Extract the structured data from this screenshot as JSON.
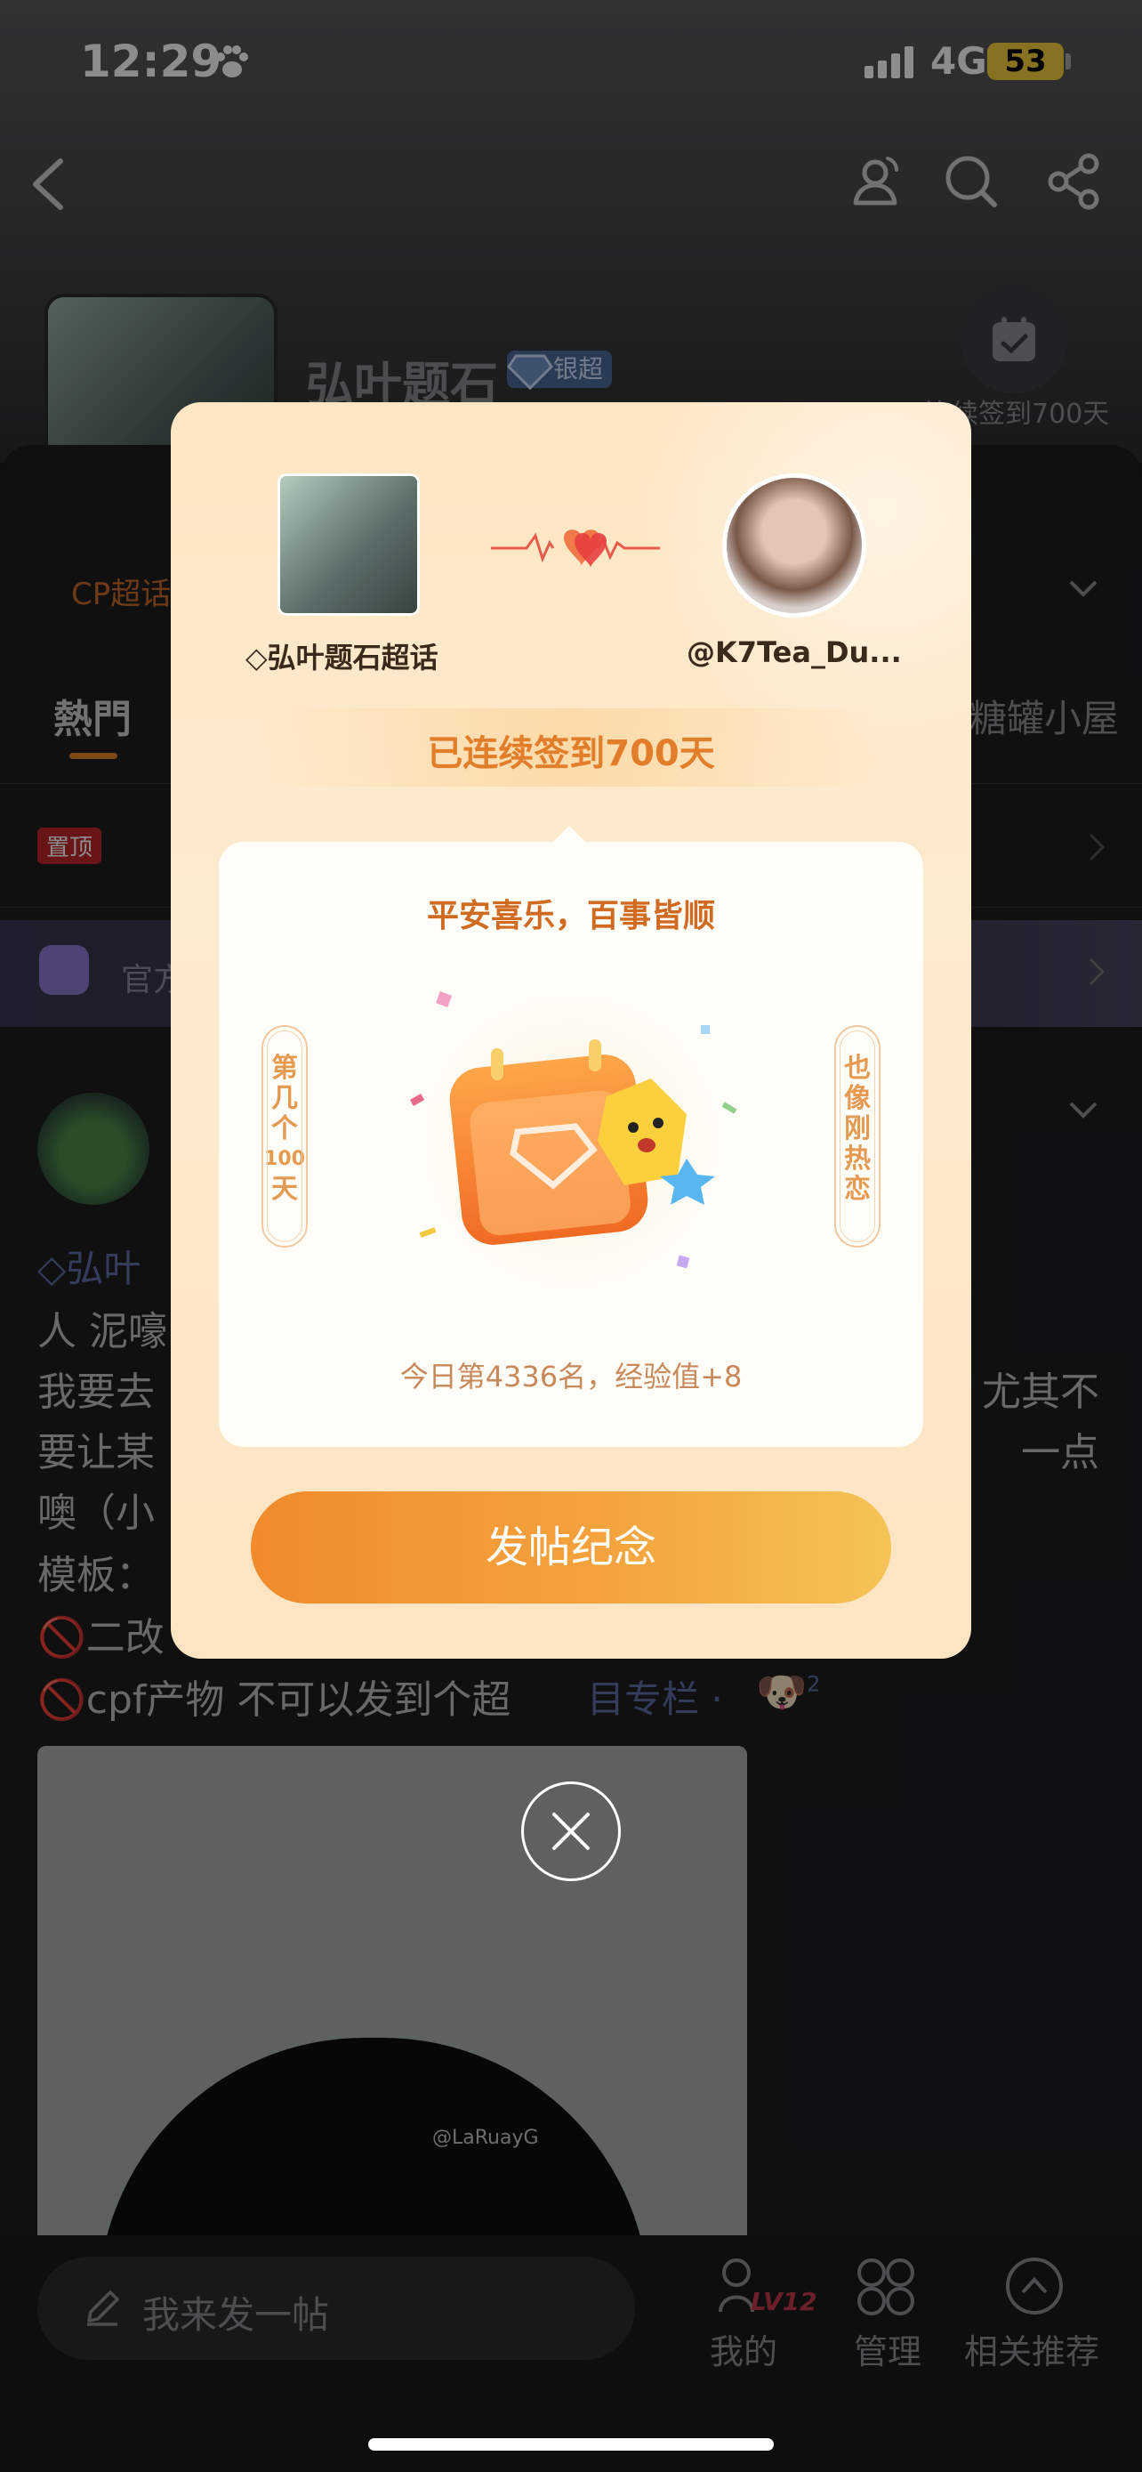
{
  "status_bar": {
    "time": "12:29",
    "network": "4G",
    "battery": "53"
  },
  "header": {
    "topic_title": "弘叶题石",
    "badge": "银超",
    "checkin_caption": "连续签到700天"
  },
  "tabs": {
    "cp_tag": "CP超话",
    "hot": "熱門",
    "right": "糖罐小屋"
  },
  "pinned": {
    "badge": "置顶",
    "text": "【"
  },
  "official": {
    "text": "官方"
  },
  "post": {
    "topic": "弘叶",
    "line1": "人 泥嚎",
    "line2_left": "我要去",
    "line2_right": "尤其不",
    "line3_left": "要让某",
    "line3_right": "一点",
    "line4": "噢（小",
    "line5": "模板：",
    "line6": "🚫二改",
    "line7": "🚫cpf产物 不可以发到个超",
    "column": "目专栏 ·",
    "emoji": "🐶",
    "emoji_count": "2",
    "watermark": "@LaRuayG"
  },
  "bottom_bar": {
    "compose_placeholder": "我来发一帖",
    "level": "LV12",
    "mine": "我的",
    "manage": "管理",
    "recommend": "相关推荐"
  },
  "modal": {
    "left_name": "弘叶题石超话",
    "right_name": "@K7Tea_Du...",
    "streak": "已连续签到700天",
    "blessing": "平安喜乐，百事皆顺",
    "side_left": [
      "第",
      "几",
      "个",
      "100",
      "天"
    ],
    "side_right": [
      "也",
      "像",
      "刚",
      "热",
      "恋"
    ],
    "rank": "今日第4336名，经验值+8",
    "button": "发帖纪念"
  }
}
